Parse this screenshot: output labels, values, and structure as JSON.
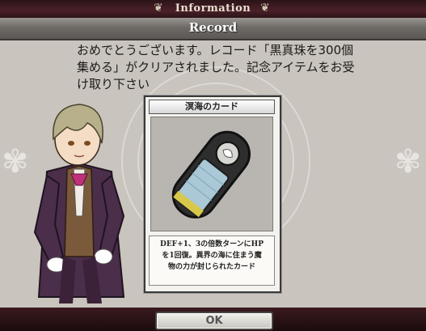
{
  "header": {
    "title": "Information"
  },
  "record": {
    "label": "Record"
  },
  "message": {
    "line1": "おめでとうございます。レコード「黒真珠を300個",
    "line2": "集める」がクリアされました。記念アイテムをお受",
    "line3": "け取り下さい"
  },
  "item_card": {
    "title": "溟海のカード",
    "desc_line1": "DEF+1、3の倍数ターンにHP",
    "desc_line2": "を1回復。異界の海に住まう魔",
    "desc_line3": "物の力が封じられたカード"
  },
  "footer": {
    "ok_label": "OK"
  },
  "colors": {
    "accent": "#4a2028",
    "panel": "#c9c4bd"
  }
}
